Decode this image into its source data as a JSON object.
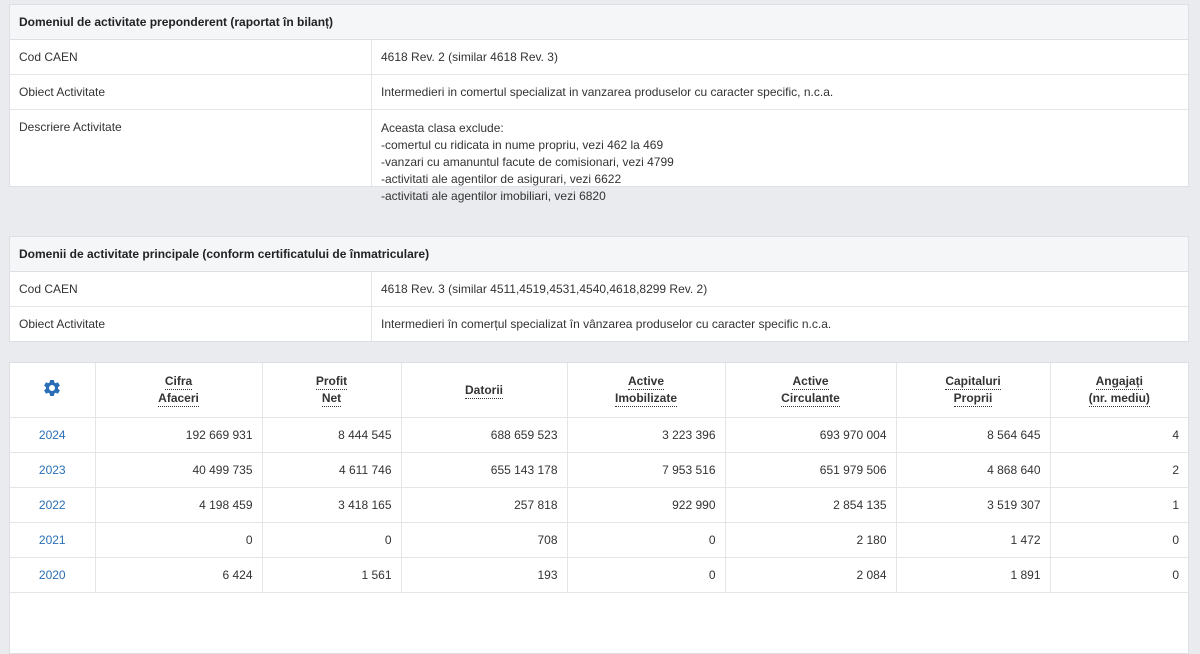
{
  "section1": {
    "title": "Domeniul de activitate preponderent (raportat în bilanț)",
    "rows": [
      {
        "label": "Cod CAEN",
        "value": "4618 Rev. 2  (similar 4618 Rev. 3)"
      },
      {
        "label": "Obiect Activitate",
        "value": "Intermedieri in comertul specializat in vanzarea produselor cu caracter specific, n.c.a."
      }
    ],
    "description": {
      "label": "Descriere Activitate",
      "lines": [
        "Aceasta clasa exclude:",
        "-comertul cu ridicata in nume propriu, vezi 462 la 469",
        "-vanzari cu amanuntul facute de comisionari, vezi 4799",
        "-activitati ale agentilor de asigurari, vezi 6622",
        "-activitati ale agentilor imobiliari, vezi 6820"
      ]
    }
  },
  "section2": {
    "title": "Domenii de activitate principale (conform certificatului de înmatriculare)",
    "rows": [
      {
        "label": "Cod CAEN",
        "value": "4618 Rev. 3  (similar 4511,4519,4531,4540,4618,8299 Rev. 2)"
      },
      {
        "label": "Obiect Activitate",
        "value": "Intermedieri în comerțul specializat în vânzarea produselor cu caracter specific n.c.a."
      }
    ]
  },
  "financial": {
    "settings_icon": "gear-icon",
    "accent": "#2a6fb5",
    "headers": [
      {
        "line1": "Cifra",
        "line2": "Afaceri"
      },
      {
        "line1": "Profit",
        "line2": "Net"
      },
      {
        "line1": "Datorii",
        "line2": ""
      },
      {
        "line1": "Active",
        "line2": "Imobilizate"
      },
      {
        "line1": "Active",
        "line2": "Circulante"
      },
      {
        "line1": "Capitaluri",
        "line2": "Proprii"
      },
      {
        "line1": "Angajați",
        "line2": "(nr. mediu)"
      }
    ],
    "rows": [
      {
        "year": "2024",
        "values": [
          "192 669 931",
          "8 444 545",
          "688 659 523",
          "3 223 396",
          "693 970 004",
          "8 564 645",
          "4"
        ]
      },
      {
        "year": "2023",
        "values": [
          "40 499 735",
          "4 611 746",
          "655 143 178",
          "7 953 516",
          "651 979 506",
          "4 868 640",
          "2"
        ]
      },
      {
        "year": "2022",
        "values": [
          "4 198 459",
          "3 418 165",
          "257 818",
          "922 990",
          "2 854 135",
          "3 519 307",
          "1"
        ]
      },
      {
        "year": "2021",
        "values": [
          "0",
          "0",
          "708",
          "0",
          "2 180",
          "1 472",
          "0"
        ]
      },
      {
        "year": "2020",
        "values": [
          "6 424",
          "1 561",
          "193",
          "0",
          "2 084",
          "1 891",
          "0"
        ]
      }
    ]
  }
}
